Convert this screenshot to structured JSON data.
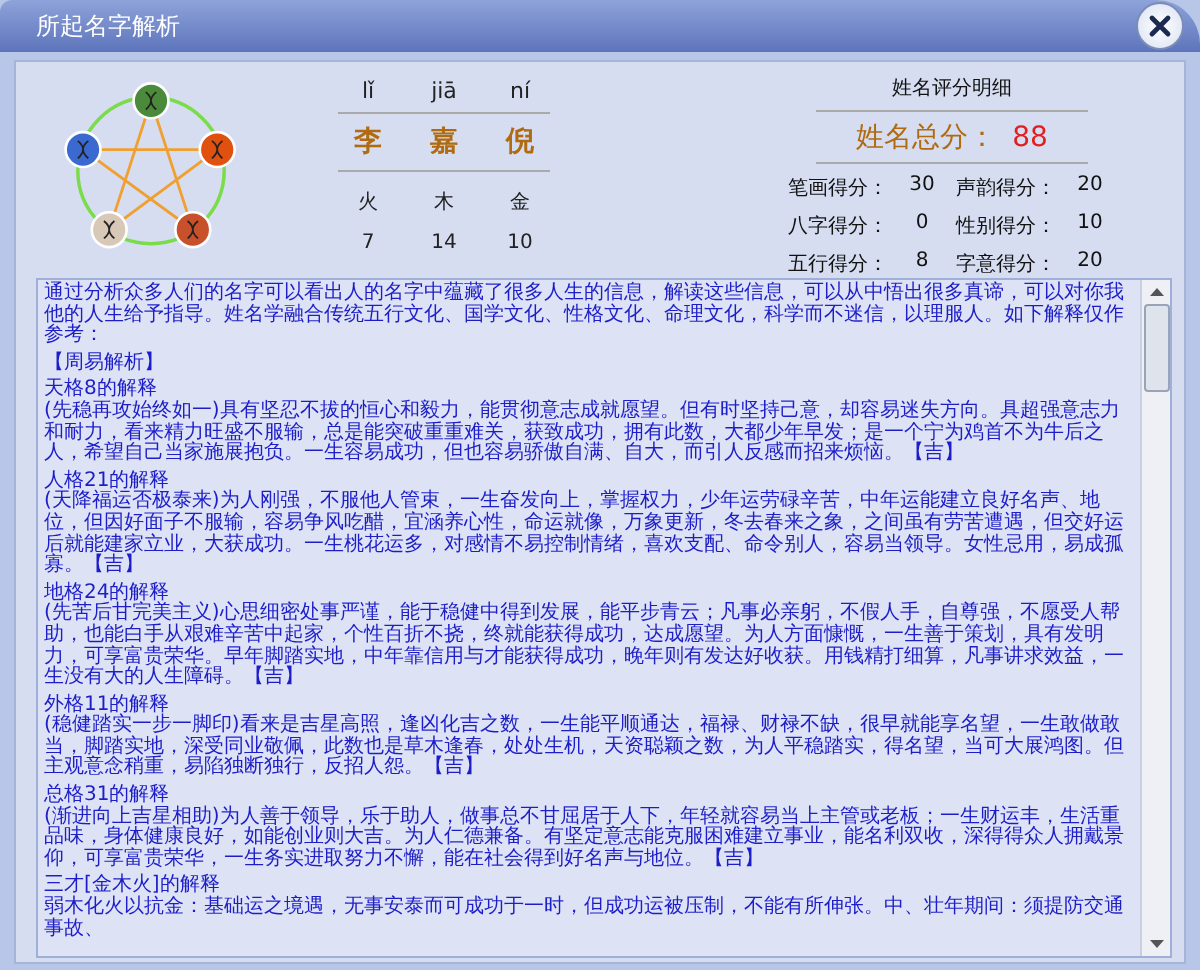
{
  "window": {
    "title": "所起名字解析"
  },
  "name": {
    "pinyin": [
      "lǐ",
      "jiā",
      "ní"
    ],
    "characters": [
      "李",
      "嘉",
      "倪"
    ],
    "elements": [
      "火",
      "木",
      "金"
    ],
    "strokes": [
      "7",
      "14",
      "10"
    ]
  },
  "score": {
    "title": "姓名评分明细",
    "total_label": "姓名总分：",
    "total": "88",
    "items": [
      {
        "label": "笔画得分：",
        "value": "30"
      },
      {
        "label": "声韵得分：",
        "value": "20"
      },
      {
        "label": "八字得分：",
        "value": "0"
      },
      {
        "label": "性别得分：",
        "value": "10"
      },
      {
        "label": "五行得分：",
        "value": "8"
      },
      {
        "label": "字意得分：",
        "value": "20"
      }
    ]
  },
  "analysis": {
    "intro": "通过分析众多人们的名字可以看出人的名字中蕴藏了很多人生的信息，解读这些信息，可以从中悟出很多真谛，可以对你我他的人生给予指导。姓名学融合传统五行文化、国学文化、性格文化、命理文化，科学而不迷信，以理服人。如下解释仅作参考：",
    "heading": "【周易解析】",
    "sections": [
      {
        "title": "天格8的解释",
        "text": "(先稳再攻始终如一)具有坚忍不拔的恒心和毅力，能贯彻意志成就愿望。但有时坚持己意，却容易迷失方向。具超强意志力和耐力，看来精力旺盛不服输，总是能突破重重难关，获致成功，拥有此数，大都少年早发；是一个宁为鸡首不为牛后之人，希望自己当家施展抱负。一生容易成功，但也容易骄傲自满、自大，而引人反感而招来烦恼。【吉】"
      },
      {
        "title": "人格21的解释",
        "text": "(天降福运否极泰来)为人刚强，不服他人管束，一生奋发向上，掌握权力，少年运劳碌辛苦，中年运能建立良好名声、地位，但因好面子不服输，容易争风吃醋，宜涵养心性，命运就像，万象更新，冬去春来之象，之间虽有劳苦遭遇，但交好运后就能建家立业，大获成功。一生桃花运多，对感情不易控制情绪，喜欢支配、命令别人，容易当领导。女性忌用，易成孤寡。【吉】"
      },
      {
        "title": "地格24的解释",
        "text": "(先苦后甘完美主义)心思细密处事严谨，能于稳健中得到发展，能平步青云；凡事必亲躬，不假人手，自尊强，不愿受人帮助，也能白手从艰难辛苦中起家，个性百折不挠，终就能获得成功，达成愿望。为人方面慷慨，一生善于策划，具有发明力，可享富贵荣华。早年脚踏实地，中年靠信用与才能获得成功，晚年则有发达好收获。用钱精打细算，凡事讲求效益，一生没有大的人生障碍。【吉】"
      },
      {
        "title": "外格11的解释",
        "text": "(稳健踏实一步一脚印)看来是吉星高照，逢凶化吉之数，一生能平顺通达，福禄、财禄不缺，很早就能享名望，一生敢做敢当，脚踏实地，深受同业敬佩，此数也是草木逢春，处处生机，天资聪颖之数，为人平稳踏实，得名望，当可大展鸿图。但主观意念稍重，易陷独断独行，反招人怨。【吉】"
      },
      {
        "title": "总格31的解释",
        "text": "(渐进向上吉星相助)为人善于领导，乐于助人，做事总不甘屈居于人下，年轻就容易当上主管或老板；一生财运丰，生活重品味，身体健康良好，如能创业则大吉。为人仁德兼备。有坚定意志能克服困难建立事业，能名利双收，深得得众人拥戴景仰，可享富贵荣华，一生务实进取努力不懈，能在社会得到好名声与地位。【吉】"
      },
      {
        "title": "三才[金木火]的解释",
        "text": "弱木化火以抗金：基础运之境遇，无事安泰而可成功于一时，但成功运被压制，不能有所伸张。中、壮年期间：须提防交通事故、"
      }
    ]
  }
}
